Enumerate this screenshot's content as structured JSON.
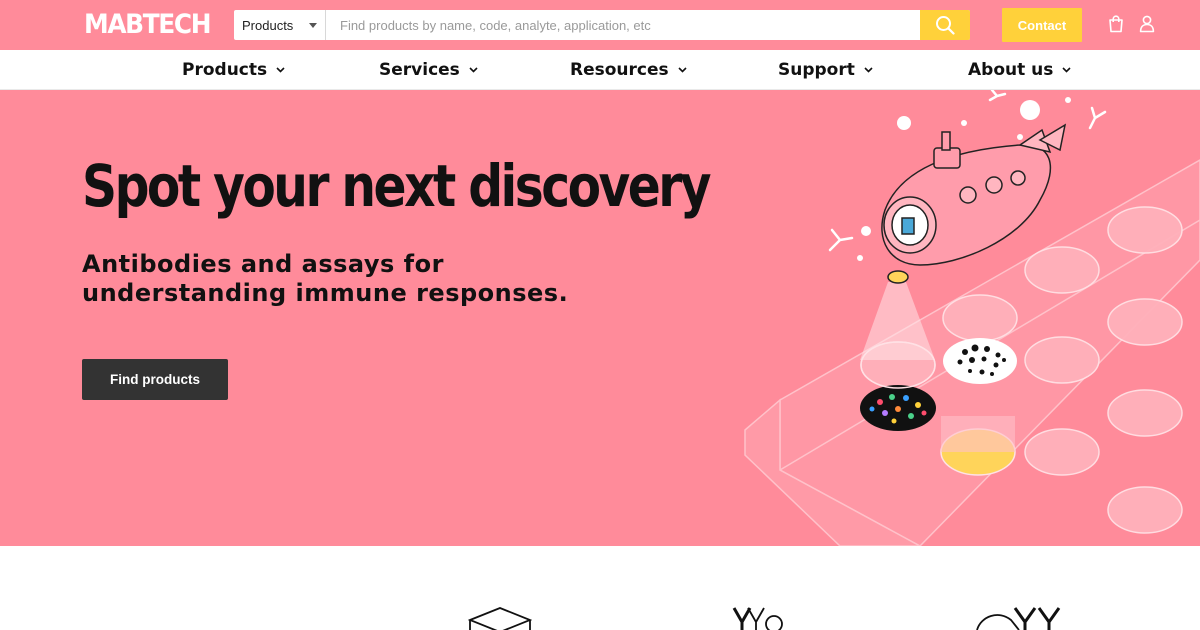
{
  "brand": {
    "logo_text": "MABTECH"
  },
  "search": {
    "category_selected": "Products",
    "placeholder": "Find products by name, code, analyte, application, etc",
    "button_icon": "search-icon"
  },
  "header_actions": {
    "contact_label": "Contact",
    "cart_icon": "shopping-bag-icon",
    "user_icon": "user-icon"
  },
  "nav": {
    "items": [
      {
        "label": "Products"
      },
      {
        "label": "Services"
      },
      {
        "label": "Resources"
      },
      {
        "label": "Support"
      },
      {
        "label": "About us"
      }
    ]
  },
  "hero": {
    "title": "Spot your next discovery",
    "subtitle": "Antibodies and assays for understanding immune responses.",
    "cta_label": "Find products",
    "illustration": "submarine-over-elispot-plate-illustration"
  },
  "colors": {
    "brand_pink": "#ff8b9a",
    "accent_yellow": "#ffd13a",
    "button_dark": "#333333",
    "text_dark": "#111111"
  }
}
